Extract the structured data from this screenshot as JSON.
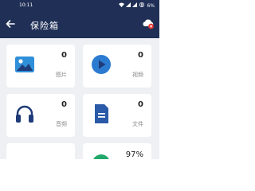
{
  "status_bar": {
    "time": "10:11",
    "icons": [
      "wifi-icon",
      "signal-icon",
      "signal-icon",
      "battery-icon"
    ],
    "battery_text": "6%"
  },
  "app_bar": {
    "title": "保险箱",
    "back_icon": "back-arrow-icon",
    "action_icon": "cloud-sync-icon"
  },
  "categories": [
    {
      "label": "图片",
      "count": "0",
      "icon": "image-icon",
      "color": "#2f8fd8"
    },
    {
      "label": "视频",
      "count": "0",
      "icon": "play-icon",
      "color": "#2b7bd0"
    },
    {
      "label": "音频",
      "count": "0",
      "icon": "headphones-icon",
      "color": "#1f3b78"
    },
    {
      "label": "文件",
      "count": "0",
      "icon": "document-icon",
      "color": "#2a5aa8"
    },
    {
      "label": "",
      "count": "",
      "icon": "",
      "color": "#cccccc"
    },
    {
      "label": "",
      "count": "97%",
      "icon": "storage-pie-icon",
      "color": "#22a86a"
    }
  ],
  "colors": {
    "header_bg": "#1f2f56",
    "page_bg": "#eef0f3",
    "card_bg": "#ffffff"
  }
}
